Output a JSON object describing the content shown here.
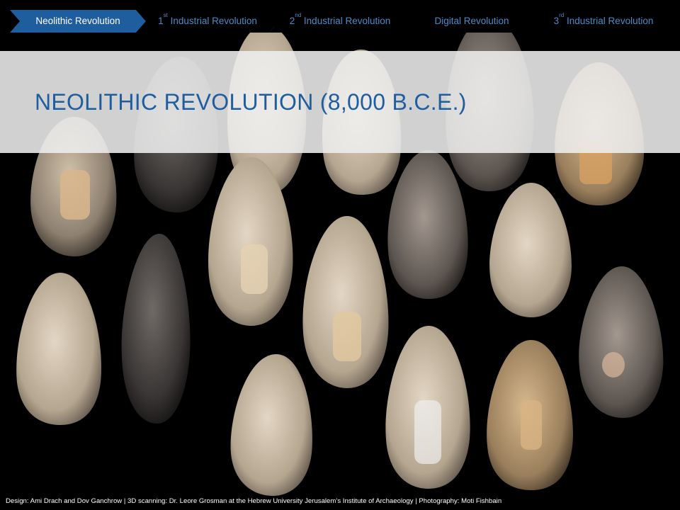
{
  "breadcrumb": {
    "items": [
      {
        "label": "Neolithic Revolution",
        "ord": "",
        "rest": "",
        "active": true
      },
      {
        "label": "1",
        "ord": "st",
        "rest": " Industrial Revolution",
        "active": false
      },
      {
        "label": "2",
        "ord": "nd",
        "rest": " Industrial Revolution",
        "active": false
      },
      {
        "label": "Digital Revolution",
        "ord": "",
        "rest": "",
        "active": false
      },
      {
        "label": "3",
        "ord": "rd",
        "rest": " Industrial Revolution",
        "active": false
      }
    ]
  },
  "title": "NEOLITHIC REVOLUTION (8,000 B.C.E.)",
  "credits": "Design: Ami Drach and Dov Ganchrow  |  3D scanning: Dr. Leore Grosman at the  Hebrew University Jerusalem’s Institute of Archaeology  |  Photography: Moti Fishbain",
  "colors": {
    "accent": "#1f5e9e",
    "inactive_text": "#4a8cc9",
    "background": "#000000",
    "title_band": "#eeeeee"
  },
  "photo": {
    "subject": "flint hand axes"
  }
}
